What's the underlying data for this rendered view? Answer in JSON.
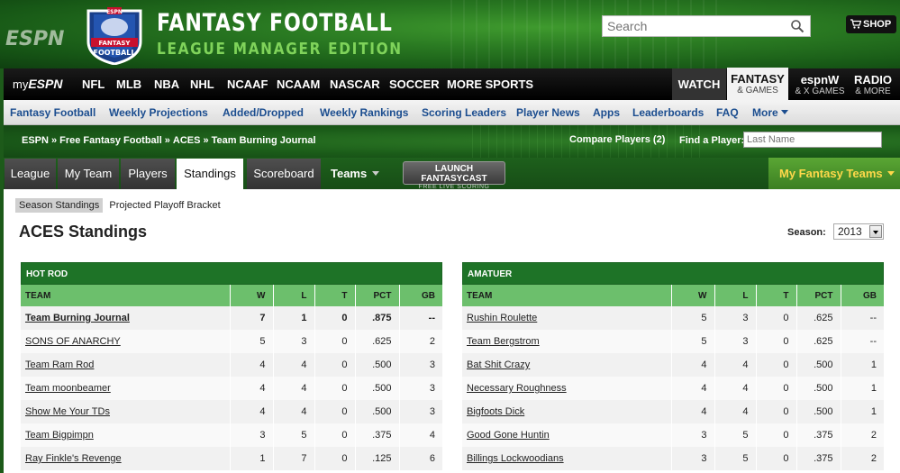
{
  "header": {
    "espn_logo": "ESPN",
    "badge_top": "ESPN",
    "badge_line1": "FANTASY",
    "badge_line2": "FOOTBALL",
    "title": "FANTASY FOOTBALL",
    "subtitle": "LEAGUE MANAGER EDITION",
    "search_placeholder": "Search",
    "shop_label": "SHOP"
  },
  "mainnav": {
    "my_prefix": "my",
    "my_brand": "ESPN",
    "items": [
      "NFL",
      "MLB",
      "NBA",
      "NHL",
      "NCAAF",
      "NCAAM",
      "NASCAR",
      "SOCCER",
      "MORE SPORTS"
    ],
    "watch": "WATCH",
    "fantasy_big": "FANTASY",
    "fantasy_small": "& GAMES",
    "espnw_big": "espnW",
    "espnw_small": "& X GAMES",
    "radio_big": "RADIO",
    "radio_small": "& MORE"
  },
  "subnav": {
    "items": [
      "Fantasy Football",
      "Weekly Projections",
      "Added/Dropped",
      "Weekly Rankings",
      "Scoring Leaders",
      "Player News",
      "Apps",
      "Leaderboards",
      "FAQ"
    ],
    "more": "More"
  },
  "breadcrumb": {
    "items": [
      "ESPN",
      "Free Fantasy Football",
      "ACES",
      "Team Burning Journal"
    ],
    "separator": "»",
    "compare": "Compare Players (2)",
    "find_label": "Find a Player:",
    "find_placeholder": "Last Name"
  },
  "tabs": {
    "items": [
      "League",
      "My Team",
      "Players",
      "Standings",
      "Scoreboard"
    ],
    "active": "Standings",
    "teams": "Teams",
    "fantasycast_line1": "LAUNCH FANTASYCAST",
    "fantasycast_line2": "FREE LIVE SCORING",
    "my_teams": "My Fantasy Teams"
  },
  "page": {
    "subtabs": [
      "Season Standings",
      "Projected Playoff Bracket"
    ],
    "title": "ACES Standings",
    "season_label": "Season:",
    "season_value": "2013"
  },
  "columns": [
    "TEAM",
    "W",
    "L",
    "T",
    "PCT",
    "GB"
  ],
  "divisions": [
    {
      "name": "HOT ROD",
      "rows": [
        [
          "Team Burning Journal",
          "7",
          "1",
          "0",
          ".875",
          "--"
        ],
        [
          "SONS OF ANARCHY",
          "5",
          "3",
          "0",
          ".625",
          "2"
        ],
        [
          "Team Ram Rod",
          "4",
          "4",
          "0",
          ".500",
          "3"
        ],
        [
          "Team moonbeamer",
          "4",
          "4",
          "0",
          ".500",
          "3"
        ],
        [
          "Show Me Your TDs",
          "4",
          "4",
          "0",
          ".500",
          "3"
        ],
        [
          "Team Bigpimpn",
          "3",
          "5",
          "0",
          ".375",
          "4"
        ],
        [
          "Ray Finkle's Revenge",
          "1",
          "7",
          "0",
          ".125",
          "6"
        ]
      ]
    },
    {
      "name": "AMATUER",
      "rows": [
        [
          "Rushin Roulette",
          "5",
          "3",
          "0",
          ".625",
          "--"
        ],
        [
          "Team Bergstrom",
          "5",
          "3",
          "0",
          ".625",
          "--"
        ],
        [
          "Bat Shit Crazy",
          "4",
          "4",
          "0",
          ".500",
          "1"
        ],
        [
          "Necessary Roughness",
          "4",
          "4",
          "0",
          ".500",
          "1"
        ],
        [
          "Bigfoots Dick",
          "4",
          "4",
          "0",
          ".500",
          "1"
        ],
        [
          "Good Gone Huntin",
          "3",
          "5",
          "0",
          ".375",
          "2"
        ],
        [
          "Billings Lockwoodians",
          "3",
          "5",
          "0",
          ".375",
          "2"
        ]
      ]
    }
  ],
  "colors": {
    "header_green": "#2a7a22",
    "division_header": "#1e7327",
    "column_header": "#6cbf6c",
    "link_blue": "#1b4d8f",
    "my_teams_text": "#ffd84a"
  }
}
